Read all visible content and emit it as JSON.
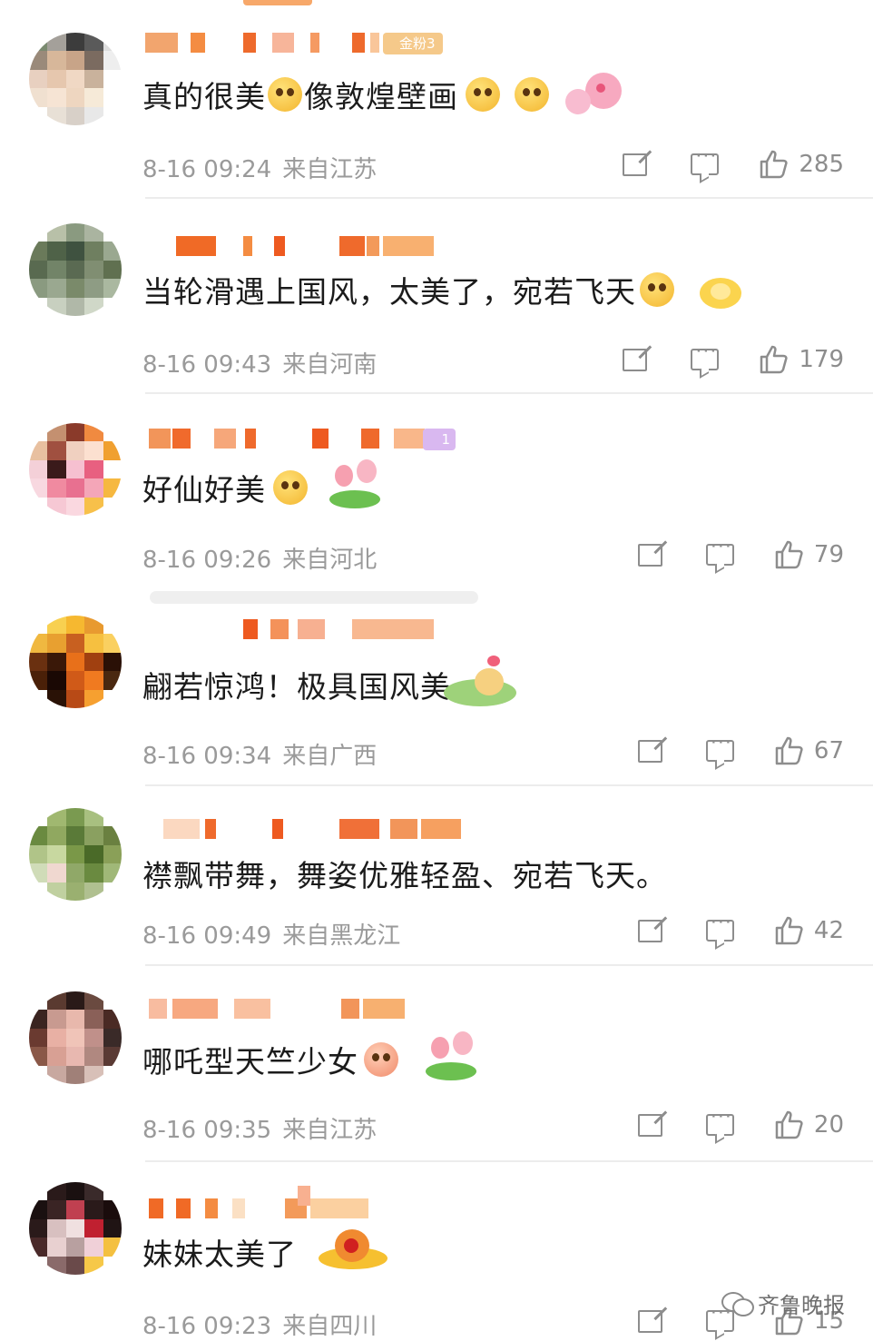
{
  "colors": {
    "text": "#1b1b1b",
    "meta": "#9a9a9a",
    "icon": "#8d8d8d",
    "badge_gold": "#f5c98a",
    "badge_purple": "#d9b8f0",
    "divider": "#ececec"
  },
  "comments": [
    {
      "badge": "金粉3",
      "text_parts": [
        "真的很美",
        "像敦煌壁画"
      ],
      "emojis": [
        "rainbow-face-emoji",
        "pleading-face-emoji",
        "pleading-face-emoji"
      ],
      "sticker": "peach-blossom-sticker",
      "date": "8-16 09:24",
      "location": "来自江苏",
      "likes": "285"
    },
    {
      "text_parts": [
        "当轮滑遇上国风，太美了，宛若飞天"
      ],
      "emojis": [
        "rainbow-face-emoji"
      ],
      "sticker": "gold-gem-sticker",
      "date": "8-16 09:43",
      "location": "来自河南",
      "likes": "179"
    },
    {
      "badge": "1",
      "text_parts": [
        "好仙好美"
      ],
      "emojis": [
        "heart-face-emoji"
      ],
      "sticker": "tulip-sticker",
      "date": "8-16 09:26",
      "location": "来自河北",
      "likes": "79"
    },
    {
      "text_parts": [
        "翩若惊鸿！极具国风美"
      ],
      "emojis": [],
      "sticker": "zongzi-sticker",
      "date": "8-16 09:34",
      "location": "来自广西",
      "likes": "67"
    },
    {
      "text_parts": [
        "襟飘带舞，舞姿优雅轻盈、宛若飞天。"
      ],
      "emojis": [],
      "sticker": "",
      "date": "8-16 09:49",
      "location": "来自黑龙江",
      "likes": "42"
    },
    {
      "text_parts": [
        "哪吒型天竺少女"
      ],
      "emojis": [
        "laughing-face-emoji"
      ],
      "sticker": "tulip-sticker",
      "date": "8-16 09:35",
      "location": "来自江苏",
      "likes": "20"
    },
    {
      "text_parts": [
        "妹妹太美了"
      ],
      "emojis": [],
      "sticker": "ufo-sticker",
      "date": "8-16 09:23",
      "location": "来自四川",
      "likes": "15"
    }
  ],
  "watermark": {
    "text": "齐鲁晚报",
    "icon": "wechat-icon"
  }
}
